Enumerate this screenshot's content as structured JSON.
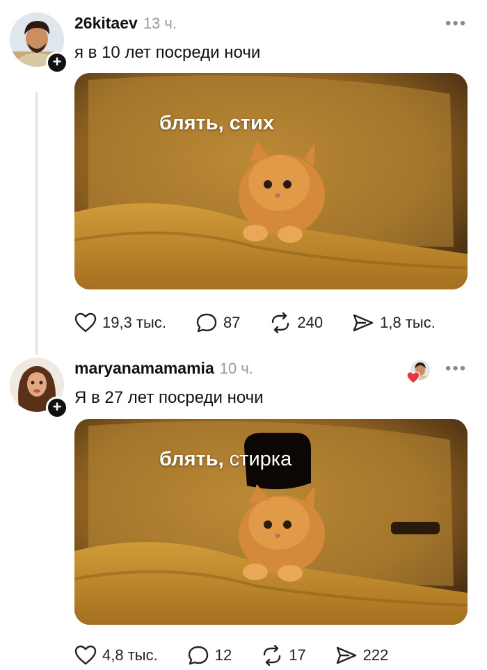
{
  "posts": [
    {
      "username": "26kitaev",
      "time": "13 ч.",
      "text": "я в 10 лет посреди ночи",
      "meme_caption_bold": "блять, стих",
      "meme_caption_thin": "",
      "stats": {
        "likes": "19,3 тыс.",
        "comments": "87",
        "reposts": "240",
        "shares": "1,8 тыс."
      }
    },
    {
      "username": "maryanamamamia",
      "time": "10 ч.",
      "text": "Я в 27 лет посреди ночи",
      "meme_caption_bold": "блять,",
      "meme_caption_thin": " стирка",
      "stats": {
        "likes": "4,8 тыс.",
        "comments": "12",
        "reposts": "17",
        "shares": "222"
      }
    }
  ],
  "icons": {
    "like": "heart-outline-icon",
    "comment": "speech-bubble-icon",
    "repost": "repost-arrows-icon",
    "share": "send-arrow-icon",
    "more": "more-dots-icon",
    "follow": "plus-icon"
  },
  "colors": {
    "muted": "#9a9a9a",
    "text": "#111111",
    "heart_red": "#e8363f",
    "image_warm": "#b8842a"
  }
}
